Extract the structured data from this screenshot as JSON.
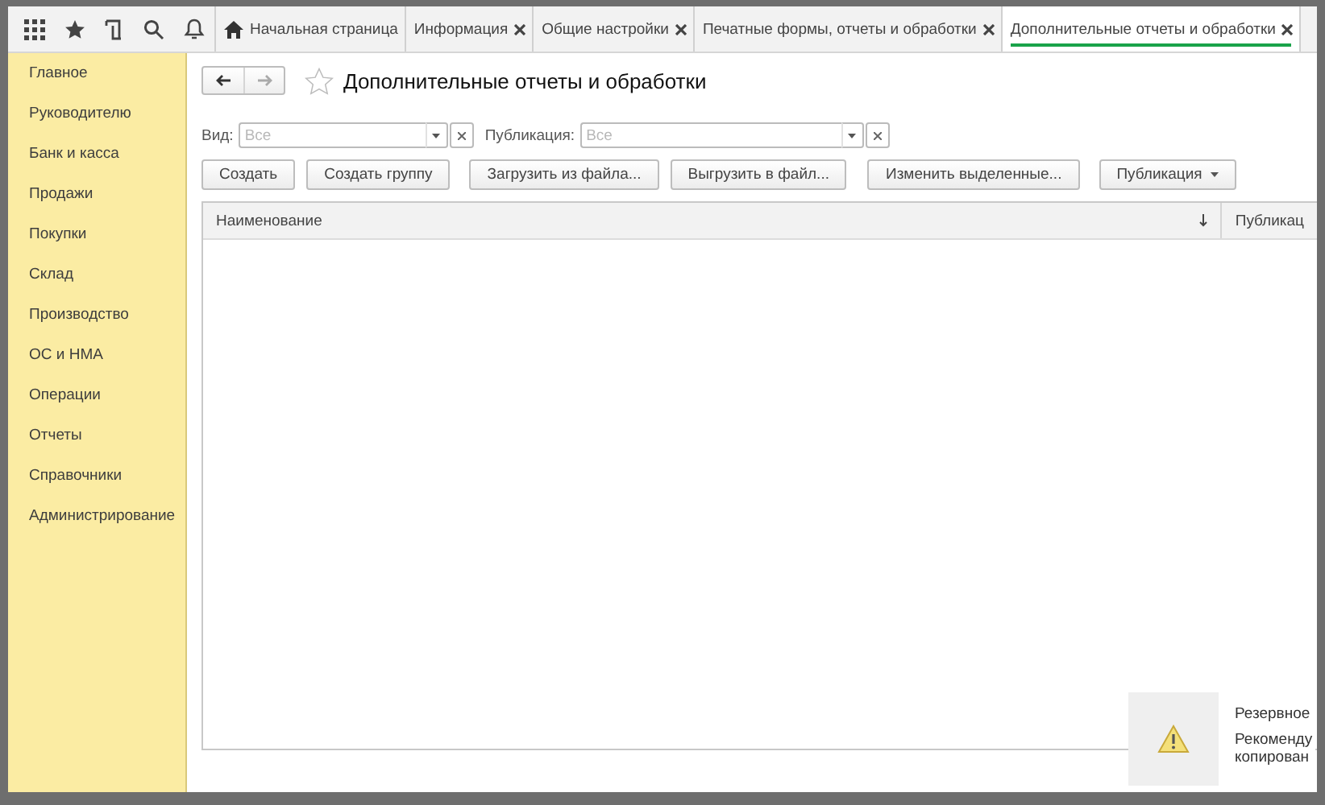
{
  "tabs": [
    {
      "label": "Начальная страница",
      "kind": "home",
      "selected": false
    },
    {
      "label": "Информация",
      "kind": "page",
      "selected": false
    },
    {
      "label": "Общие настройки",
      "kind": "page",
      "selected": false
    },
    {
      "label": "Печатные формы, отчеты и обработки",
      "kind": "page",
      "selected": false
    },
    {
      "label": "Дополнительные отчеты и обработки",
      "kind": "page",
      "selected": true
    }
  ],
  "sidebar": {
    "items": [
      "Главное",
      "Руководителю",
      "Банк и касса",
      "Продажи",
      "Покупки",
      "Склад",
      "Производство",
      "ОС и НМА",
      "Операции",
      "Отчеты",
      "Справочники",
      "Администрирование"
    ]
  },
  "form": {
    "title": "Дополнительные отчеты и обработки",
    "back_disabled": false,
    "forward_disabled": true,
    "favorite": false,
    "filters": [
      {
        "label": "Вид:",
        "placeholder": "Все"
      },
      {
        "label": "Публикация:",
        "placeholder": "Все"
      }
    ],
    "buttons": [
      {
        "label": "Создать",
        "kind": "plain"
      },
      {
        "label": "Создать группу",
        "kind": "plain"
      },
      {
        "label": "Загрузить из файла...",
        "kind": "plain"
      },
      {
        "label": "Выгрузить в файл...",
        "kind": "plain"
      },
      {
        "label": "Изменить выделенные...",
        "kind": "plain"
      },
      {
        "label": "Публикация",
        "kind": "menu"
      }
    ],
    "table": {
      "columns": [
        {
          "label": "Наименование",
          "sorted": true
        },
        {
          "label": "Публикац",
          "sorted": false
        }
      ]
    }
  },
  "notification": {
    "title": "Резервное",
    "lines": [
      "Рекоменду",
      "копирован"
    ]
  }
}
